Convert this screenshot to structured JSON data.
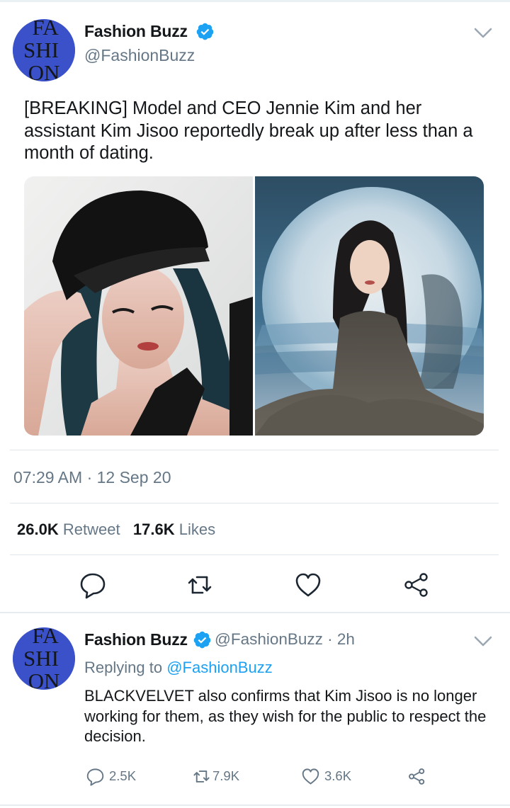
{
  "main_tweet": {
    "author": {
      "name": "Fashion Buzz",
      "handle": "@FashionBuzz",
      "avatar_text": [
        "FA",
        "SHI",
        "ON"
      ],
      "avatar_color": "#3b51c9"
    },
    "text": "[BREAKING] Model and CEO Jennie Kim and her assistant Kim Jisoo reportedly break up after less than a month of dating.",
    "timestamp": "07:29 AM · 12 Sep 20",
    "stats": {
      "retweets_count": "26.0K",
      "retweets_label": "Retweet",
      "likes_count": "17.6K",
      "likes_label": "Likes"
    },
    "actions": [
      "reply-icon",
      "retweet-icon",
      "heart-icon",
      "share-icon"
    ]
  },
  "reply_tweet": {
    "author": {
      "name": "Fashion Buzz",
      "handle_time": "@FashionBuzz · 2h"
    },
    "replying_prefix": "Replying to",
    "replying_handle": "@FashionBuzz",
    "text": "BLACKVELVET also confirms that Kim Jisoo is no longer working for them, as they wish for the public to respect the decision.",
    "counts": {
      "replies": "2.5K",
      "retweets": "7.9K",
      "likes": "3.6K"
    }
  },
  "colors": {
    "verified": "#1da1f2",
    "link": "#1da1f2",
    "secondary_text": "#657786",
    "icon": "#657786"
  }
}
